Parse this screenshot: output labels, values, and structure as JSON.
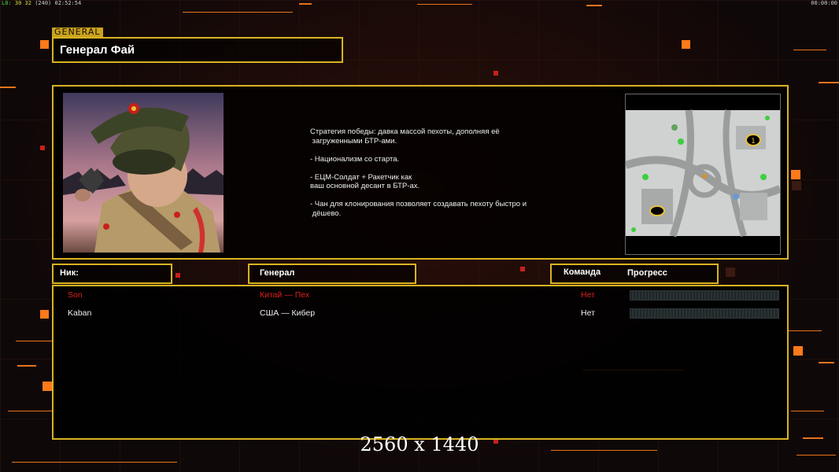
{
  "hud": {
    "stats_left_1": "L8:",
    "stats_left_2": "30",
    "stats_left_3": "32",
    "stats_left_4": "(240)",
    "clock_left": "02:52:54",
    "clock_right": "00:00:00"
  },
  "general_tag": "GENERAL",
  "title": "Генерал Фай",
  "strategy_lines": [
    "Стратегия победы: давка массой пехоты, дополняя её",
    " загруженными БТР-ами.",
    "",
    "- Национализм со старта.",
    "",
    "- ЕЦМ-Солдат + Ракетчик как",
    "ваш основной десант в БТР-ах.",
    "",
    "- Чан для клонирования позволяет создавать пехоту быстро и",
    " дёшево."
  ],
  "minimap": {
    "marker_label": "1"
  },
  "headers": {
    "nick": "Ник:",
    "general": "Генерал",
    "team": "Команда",
    "progress": "Прогресс"
  },
  "players": [
    {
      "name": "Son",
      "general": "Китай — Пех",
      "team": "Нет",
      "color": "#e01e1e"
    },
    {
      "name": "Kaban",
      "general": "США — Кибер",
      "team": "Нет",
      "color": "#f0f0f0"
    }
  ],
  "resolution": "2560 x 1440",
  "colors": {
    "accent": "#d9b321",
    "orange": "#ff7a1a",
    "player_red": "#e01e1e"
  }
}
